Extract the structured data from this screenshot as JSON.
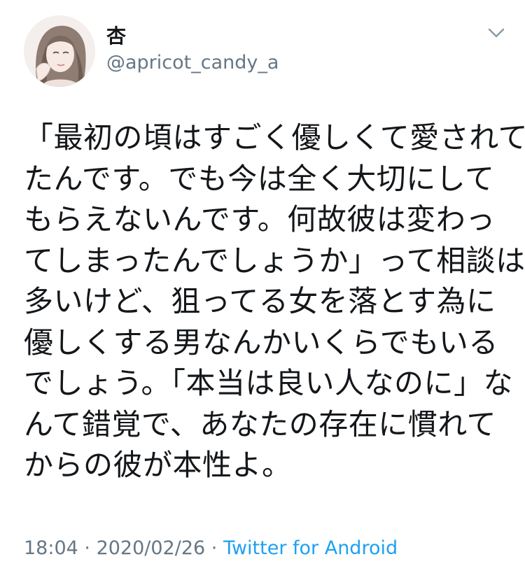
{
  "tweet": {
    "display_name": "杏",
    "handle": "@apricot_candy_a",
    "text_lines": [
      "「最初の頃はすごく優しくて愛されて",
      "たんです。でも今は全く大切にして",
      "もらえないんです。何故彼は変わっ",
      "てしまったんでしょうか」って相談は",
      "多いけど、狙ってる女を落とす為に",
      "優しくする男なんかいくらでもいる",
      "でしょう。「本当は良い人なのに」な",
      "んて錯覚で、あなたの存在に慣れて",
      "からの彼が本性よ。"
    ],
    "time": "18:04",
    "separator": " · ",
    "date": "2020/02/26",
    "source": "Twitter for Android"
  },
  "icons": {
    "caret": "chevron-down-icon",
    "avatar": "profile-avatar-illustration"
  },
  "colors": {
    "text": "#14171a",
    "secondary": "#657786",
    "link": "#1da1f2",
    "background": "#ffffff"
  }
}
